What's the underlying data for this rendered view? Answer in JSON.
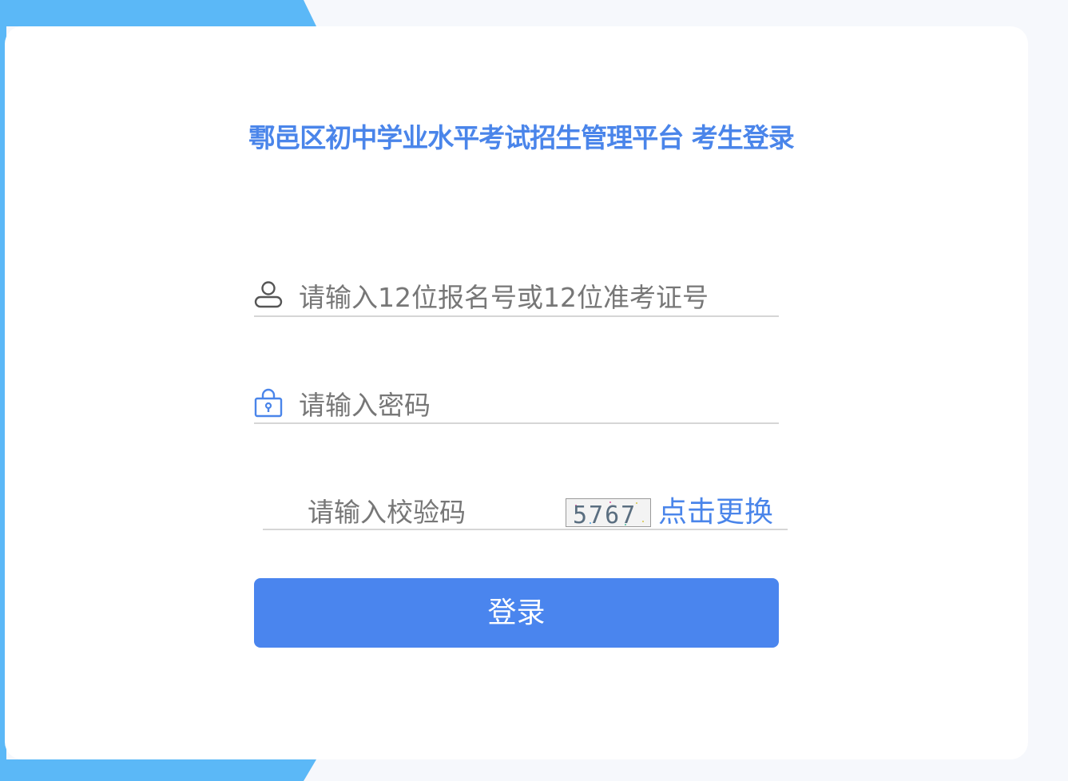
{
  "colors": {
    "primary": "#4a85ea",
    "button": "#4a85ee",
    "stripe": "#5bb8f7",
    "placeholder": "#777777"
  },
  "page": {
    "title": "鄠邑区初中学业水平考试招生管理平台 考生登录"
  },
  "form": {
    "username": {
      "icon": "user-icon",
      "placeholder": "请输入12位报名号或12位准考证号",
      "value": ""
    },
    "password": {
      "icon": "lock-icon",
      "placeholder": "请输入密码",
      "value": ""
    },
    "captcha": {
      "placeholder": "请输入校验码",
      "value": "",
      "image_text": "5767",
      "refresh_label": "点击更换"
    },
    "login_label": "登录"
  }
}
